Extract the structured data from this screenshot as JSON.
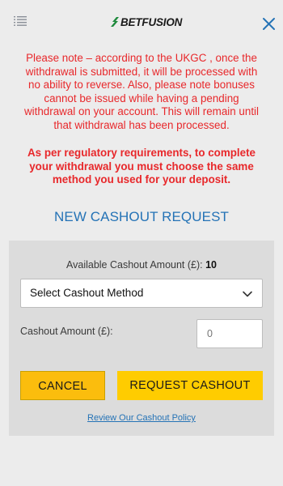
{
  "header": {
    "logo_text": "BETFUSION",
    "menu_icon": "list-icon",
    "close_icon": "close-icon"
  },
  "notice": {
    "line1": "Please note – according to the UKGC , once the",
    "line2": "withdrawal is submitted, it will be processed with",
    "line3": "no ability to reverse. Also, please note bonuses",
    "line4": "cannot be issued while having a pending",
    "line5": "withdrawal on your account. This will remain until",
    "line6": "that withdrawal has been processed.",
    "bold1": "As per regulatory requirements, to complete",
    "bold2": "your withdrawal you must choose the same",
    "bold3": "method you used for your deposit."
  },
  "title": "NEW CASHOUT REQUEST",
  "form": {
    "available_label": "Available Cashout Amount (£): ",
    "available_value": "10",
    "select_value": "Select Cashout Method",
    "amount_label": "Cashout Amount (£):",
    "amount_placeholder": "0",
    "cancel_label": "CANCEL",
    "request_label": "REQUEST CASHOUT",
    "policy_link": "Review Our Cashout Policy"
  },
  "colors": {
    "accent_blue": "#2573b6",
    "warning_red": "#e8282b",
    "button_yellow": "#ffcc00"
  }
}
